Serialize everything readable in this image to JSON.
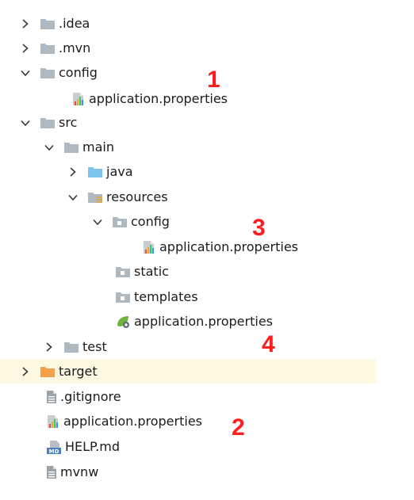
{
  "tree": {
    "idea": {
      "label": ".idea"
    },
    "mvn": {
      "label": ".mvn"
    },
    "config_root": {
      "label": "config"
    },
    "config_root_props": {
      "label": "application.properties"
    },
    "src": {
      "label": "src"
    },
    "main": {
      "label": "main"
    },
    "java": {
      "label": "java"
    },
    "resources": {
      "label": "resources"
    },
    "resources_config": {
      "label": "config"
    },
    "resources_config_props": {
      "label": "application.properties"
    },
    "static": {
      "label": "static"
    },
    "templates": {
      "label": "templates"
    },
    "resources_props": {
      "label": "application.properties"
    },
    "test": {
      "label": "test"
    },
    "target": {
      "label": "target"
    },
    "gitignore": {
      "label": ".gitignore"
    },
    "root_props": {
      "label": "application.properties"
    },
    "help": {
      "label": "HELP.md"
    },
    "mvnw": {
      "label": "mvnw"
    }
  },
  "annotations": [
    "1",
    "2",
    "3",
    "4"
  ],
  "colors": {
    "folder_gray": "#aeb9c2",
    "folder_source_blue": "#7cc6ee",
    "folder_excluded_orange": "#f4a04a",
    "highlight_row": "#fcf8e1",
    "annotation_red": "#ff1e1e"
  }
}
